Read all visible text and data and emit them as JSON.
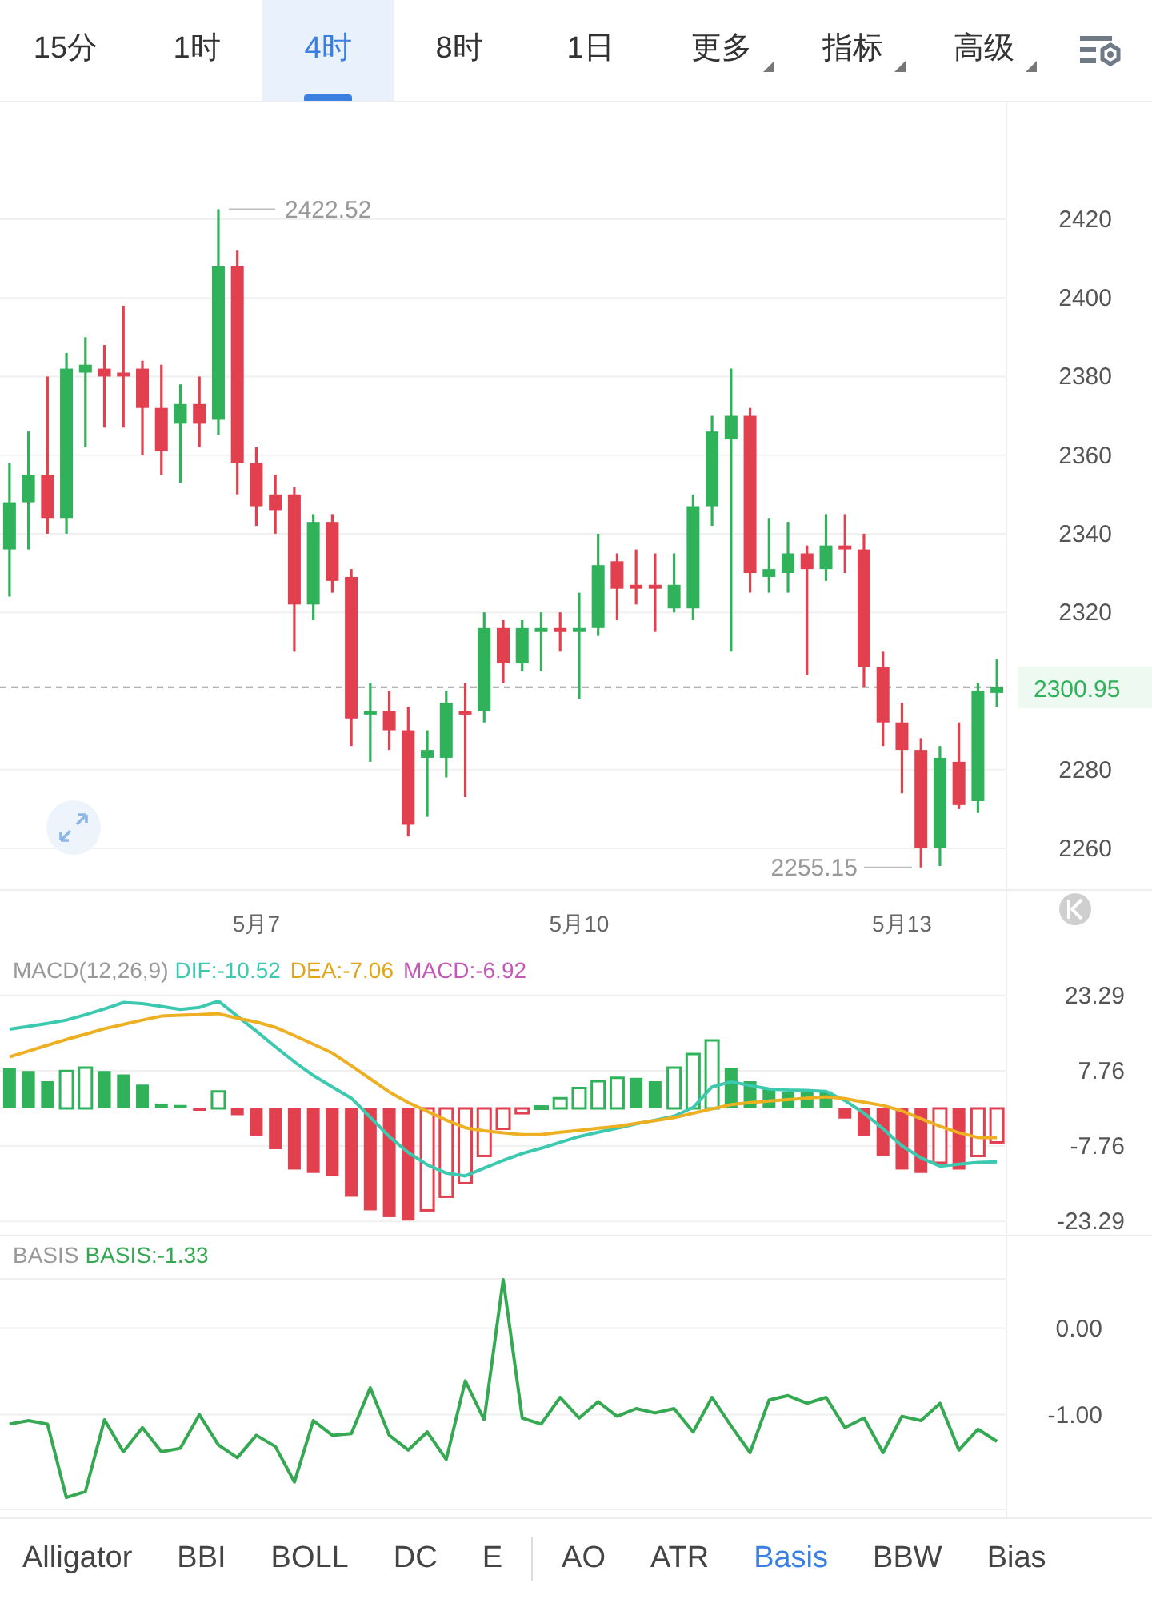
{
  "timeframe_tabs": [
    {
      "label": "15分",
      "selected": false,
      "kind": "plain"
    },
    {
      "label": "1时",
      "selected": false,
      "kind": "plain"
    },
    {
      "label": "4时",
      "selected": true,
      "kind": "plain"
    },
    {
      "label": "8时",
      "selected": false,
      "kind": "plain"
    },
    {
      "label": "1日",
      "selected": false,
      "kind": "plain"
    },
    {
      "label": "更多",
      "selected": false,
      "kind": "dropdown"
    },
    {
      "label": "指标",
      "selected": false,
      "kind": "dropdown"
    },
    {
      "label": "高级",
      "selected": false,
      "kind": "dropdown"
    }
  ],
  "price_chart": {
    "high_marker": "2422.52",
    "low_marker": "2255.15",
    "chart_data": {
      "type": "candlestick",
      "ylim": [
        2249.4,
        2449.7
      ],
      "ref_lines": [
        {
          "axis": "y",
          "value": 2300.95,
          "label": "2300.95"
        }
      ],
      "yticks": [
        {
          "value": 2420,
          "label": "2420"
        },
        {
          "value": 2400,
          "label": "2400"
        },
        {
          "value": 2380,
          "label": "2380"
        },
        {
          "value": 2360,
          "label": "2360"
        },
        {
          "value": 2340,
          "label": "2340"
        },
        {
          "value": 2320,
          "label": "2320"
        },
        {
          "value": 2280,
          "label": "2280"
        },
        {
          "value": 2260,
          "label": "2260"
        }
      ],
      "grid": true,
      "categories": [
        null,
        null,
        null,
        null,
        null,
        null,
        null,
        null,
        null,
        null,
        null,
        null,
        null,
        "5月7",
        null,
        null,
        null,
        null,
        null,
        null,
        null,
        null,
        null,
        null,
        null,
        null,
        null,
        null,
        null,
        null,
        "5月10",
        null,
        null,
        null,
        null,
        null,
        null,
        null,
        null,
        null,
        null,
        null,
        null,
        null,
        null,
        null,
        null,
        "5月13",
        null,
        null,
        null,
        null,
        null
      ],
      "ohlc": [
        [
          2336,
          2358,
          2324,
          2348
        ],
        [
          2348,
          2366,
          2336,
          2355
        ],
        [
          2355,
          2380,
          2340,
          2344
        ],
        [
          2344,
          2386,
          2340,
          2382
        ],
        [
          2381,
          2390,
          2362,
          2383
        ],
        [
          2382,
          2388,
          2367,
          2380
        ],
        [
          2381,
          2398,
          2367,
          2380
        ],
        [
          2382,
          2384,
          2360,
          2372
        ],
        [
          2372,
          2383,
          2355,
          2361
        ],
        [
          2368,
          2378,
          2353,
          2373
        ],
        [
          2373,
          2380,
          2362,
          2368
        ],
        [
          2369,
          2422.52,
          2365,
          2408
        ],
        [
          2408,
          2412,
          2350,
          2358
        ],
        [
          2358,
          2362,
          2342,
          2347
        ],
        [
          2350,
          2355,
          2340,
          2346
        ],
        [
          2350,
          2352,
          2310,
          2322
        ],
        [
          2322,
          2345,
          2318,
          2343
        ],
        [
          2343,
          2345,
          2325,
          2328
        ],
        [
          2329,
          2331,
          2286,
          2293
        ],
        [
          2294,
          2302,
          2282,
          2295
        ],
        [
          2295,
          2300,
          2285,
          2290
        ],
        [
          2290,
          2296,
          2263,
          2266
        ],
        [
          2283,
          2290,
          2268,
          2285
        ],
        [
          2283,
          2300,
          2278,
          2297
        ],
        [
          2295,
          2302,
          2273,
          2294
        ],
        [
          2295,
          2320,
          2292,
          2316
        ],
        [
          2316,
          2318,
          2302,
          2307
        ],
        [
          2307,
          2318,
          2305,
          2316
        ],
        [
          2315,
          2320,
          2305,
          2316
        ],
        [
          2316,
          2320,
          2310,
          2315
        ],
        [
          2315,
          2325,
          2298,
          2316
        ],
        [
          2316,
          2340,
          2314,
          2332
        ],
        [
          2333,
          2335,
          2318,
          2326
        ],
        [
          2327,
          2336,
          2322,
          2326
        ],
        [
          2327,
          2335,
          2315,
          2326
        ],
        [
          2321,
          2335,
          2320,
          2327
        ],
        [
          2321,
          2350,
          2318,
          2347
        ],
        [
          2347,
          2370,
          2342,
          2366
        ],
        [
          2364,
          2382,
          2310,
          2370
        ],
        [
          2370,
          2372,
          2325,
          2330
        ],
        [
          2329,
          2344,
          2325,
          2331
        ],
        [
          2330,
          2343,
          2325,
          2335
        ],
        [
          2335,
          2337,
          2304,
          2331
        ],
        [
          2331,
          2345,
          2328,
          2337
        ],
        [
          2337,
          2345,
          2330,
          2336
        ],
        [
          2336,
          2340,
          2301,
          2306
        ],
        [
          2306,
          2310,
          2286,
          2292
        ],
        [
          2292,
          2297,
          2274,
          2285
        ],
        [
          2285,
          2288,
          2255.15,
          2260
        ],
        [
          2260,
          2286,
          2255.5,
          2283
        ],
        [
          2282,
          2292,
          2270,
          2271
        ],
        [
          2272,
          2302,
          2269,
          2300
        ],
        [
          2299.5,
          2308,
          2296,
          2300.95
        ]
      ]
    }
  },
  "macd": {
    "title": "MACD(12,26,9)",
    "dif": "DIF:-10.52",
    "dea": "DEA:-7.06",
    "macd": "MACD:-6.92",
    "chart_data": {
      "type": "bar",
      "grid": true,
      "ylim": [
        -26.2,
        31.8
      ],
      "yticks": [
        {
          "value": 23.29,
          "label": "23.29"
        },
        {
          "value": 7.76,
          "label": "7.76"
        },
        {
          "value": -7.76,
          "label": "-7.76"
        },
        {
          "value": -23.29,
          "label": "-23.29"
        }
      ],
      "series": [
        {
          "type": "bar",
          "colors": [
            "#2fb25a",
            "#2fb25a",
            "#2fb25a",
            "#2fb25a",
            "#2fb25a",
            "#2fb25a",
            "#2fb25a",
            "#2fb25a",
            "#2fb25a",
            "#2fb25a",
            "#e2404f",
            "#2fb25a",
            "#e2404f",
            "#e2404f",
            "#e2404f",
            "#e2404f",
            "#e2404f",
            "#e2404f",
            "#e2404f",
            "#e2404f",
            "#e2404f",
            "#e2404f",
            "#e2404f",
            "#e2404f",
            "#e2404f",
            "#e2404f",
            "#e2404f",
            "#e2404f",
            "#2fb25a",
            "#2fb25a",
            "#2fb25a",
            "#2fb25a",
            "#2fb25a",
            "#2fb25a",
            "#2fb25a",
            "#2fb25a",
            "#2fb25a",
            "#2fb25a",
            "#2fb25a",
            "#2fb25a",
            "#2fb25a",
            "#2fb25a",
            "#2fb25a",
            "#2fb25a",
            "#e2404f",
            "#e2404f",
            "#e2404f",
            "#e2404f",
            "#e2404f",
            "#e2404f",
            "#e2404f",
            "#e2404f",
            "#e2404f"
          ],
          "values": [
            8.4,
            7.7,
            5.6,
            7.7,
            8.4,
            7.7,
            7,
            4.9,
            1,
            0.7,
            -0.4,
            3.5,
            -1.4,
            -5.6,
            -8.4,
            -12.6,
            -13.3,
            -14,
            -18.2,
            -21,
            -22.4,
            -23.1,
            -21,
            -18.2,
            -15.4,
            -9.8,
            -4.2,
            -1,
            0.4,
            2.1,
            4.2,
            5.6,
            6.3,
            6.3,
            5.6,
            8.4,
            11.2,
            14,
            8.4,
            5.6,
            4.2,
            3.5,
            3.5,
            3.5,
            -2.1,
            -5.6,
            -9.8,
            -12.6,
            -13.3,
            -11.2,
            -12.6,
            -9.8,
            -7
          ]
        },
        {
          "type": "line",
          "color": "#3cc9b0",
          "values": [
            16.3,
            16.9,
            17.5,
            18.2,
            19.3,
            20.5,
            21.8,
            21.6,
            21,
            20.4,
            20.8,
            22.1,
            19,
            15.9,
            12.7,
            9.6,
            6.8,
            4.4,
            2.1,
            -1.8,
            -5.8,
            -9.1,
            -11.6,
            -13.3,
            -13.9,
            -12.3,
            -10.7,
            -9.3,
            -8.2,
            -7,
            -5.8,
            -4.9,
            -4.1,
            -3.2,
            -2.4,
            -1.6,
            0.2,
            4.4,
            5.5,
            4.7,
            4,
            3.8,
            3.7,
            3.5,
            1.6,
            -1,
            -4.2,
            -7.7,
            -10.2,
            -11.9,
            -11.5,
            -11.1,
            -11
          ]
        },
        {
          "type": "line",
          "color": "#eeb023",
          "values": [
            10.6,
            11.8,
            13,
            14.2,
            15.3,
            16.4,
            17.3,
            18.2,
            19,
            19.2,
            19.3,
            19.5,
            18.6,
            17.8,
            16.7,
            15,
            13.2,
            11.4,
            8.8,
            6.1,
            3.4,
            1.2,
            -0.6,
            -2.4,
            -4,
            -4.6,
            -5,
            -5.4,
            -5.4,
            -4.9,
            -4.5,
            -4.1,
            -3.7,
            -3.1,
            -2.5,
            -1.9,
            -1,
            -0.1,
            0.8,
            1.2,
            1.5,
            1.8,
            2.1,
            2.4,
            2,
            1.3,
            0.6,
            -0.5,
            -2.1,
            -3.7,
            -5,
            -6,
            -6
          ]
        }
      ]
    }
  },
  "basis": {
    "title": "BASIS",
    "value": "BASIS:-1.33",
    "chart_data": {
      "type": "line",
      "grid": true,
      "ylim": [
        -2.19,
        1.07
      ],
      "yticks": [
        {
          "value": 0,
          "label": "0.00"
        },
        {
          "value": -1,
          "label": "-1.00"
        }
      ],
      "series": [
        {
          "color": "#35a852",
          "values": [
            -1.11,
            -1.07,
            -1.11,
            -1.96,
            -1.89,
            -1.06,
            -1.43,
            -1.15,
            -1.43,
            -1.39,
            -1.0,
            -1.35,
            -1.5,
            -1.24,
            -1.37,
            -1.78,
            -1.07,
            -1.24,
            -1.22,
            -0.69,
            -1.24,
            -1.41,
            -1.2,
            -1.52,
            -0.61,
            -1.06,
            0.56,
            -1.04,
            -1.11,
            -0.8,
            -1.04,
            -0.85,
            -1.02,
            -0.93,
            -0.98,
            -0.93,
            -1.2,
            -0.8,
            -1.13,
            -1.44,
            -0.83,
            -0.78,
            -0.87,
            -0.8,
            -1.15,
            -1.04,
            -1.44,
            -1.02,
            -1.07,
            -0.87,
            -1.41,
            -1.17,
            -1.31
          ]
        }
      ]
    }
  },
  "main_indicator_tabs": [
    {
      "label": "Alligator",
      "selected": false
    },
    {
      "label": "BBI",
      "selected": false
    },
    {
      "label": "BOLL",
      "selected": false
    },
    {
      "label": "DC",
      "selected": false
    },
    {
      "label": "E",
      "selected": false
    }
  ],
  "sub_indicator_tabs": [
    {
      "label": "AO",
      "selected": false
    },
    {
      "label": "ATR",
      "selected": false
    },
    {
      "label": "Basis",
      "selected": true
    },
    {
      "label": "BBW",
      "selected": false
    },
    {
      "label": "Bias",
      "selected": false
    }
  ]
}
